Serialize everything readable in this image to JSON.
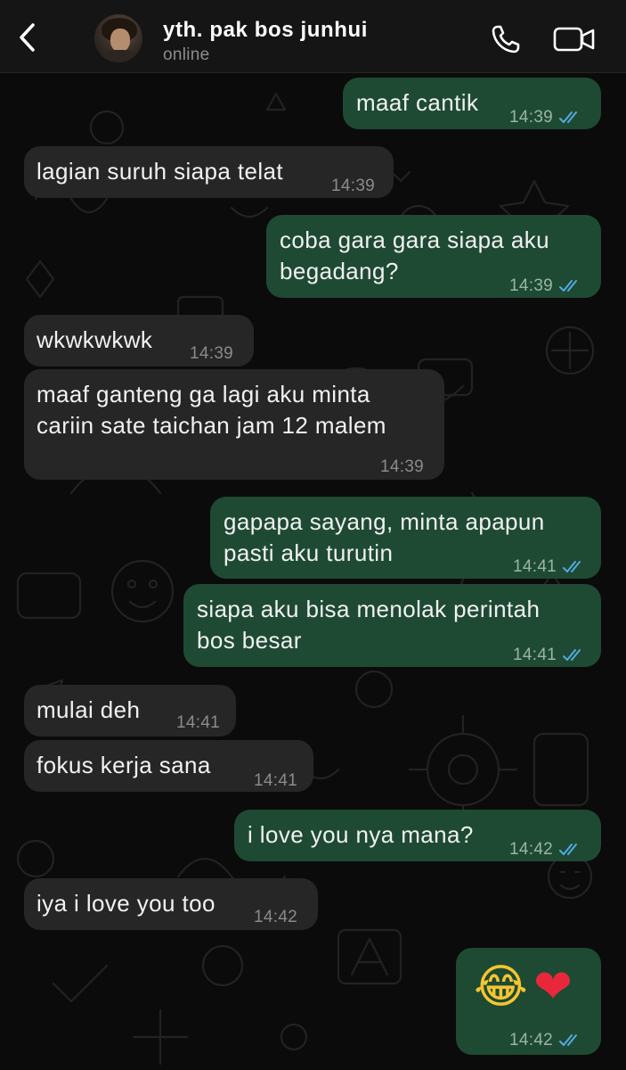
{
  "header": {
    "contact_name": "yth. pak bos junhui",
    "status": "online",
    "icons": {
      "back": "chevron-left-icon",
      "call": "phone-icon",
      "video": "video-camera-icon"
    }
  },
  "colors": {
    "background": "#0b0b0b",
    "header": "#151515",
    "incoming_bubble": "#262626",
    "outgoing_bubble": "#1e4a33",
    "read_ticks": "#53a9e4"
  },
  "messages": [
    {
      "direction": "out",
      "lines": [
        "maaf cantik"
      ],
      "time": "14:39",
      "read": true
    },
    {
      "direction": "in",
      "lines": [
        "lagian suruh siapa telat"
      ],
      "time": "14:39"
    },
    {
      "direction": "out",
      "lines": [
        "coba gara gara siapa aku",
        "begadang?"
      ],
      "time": "14:39",
      "read": true
    },
    {
      "direction": "in",
      "lines": [
        "wkwkwkwk"
      ],
      "time": "14:39"
    },
    {
      "direction": "in",
      "lines": [
        "maaf ganteng ga lagi aku minta",
        "cariin sate taichan jam 12 malem"
      ],
      "time": "14:39"
    },
    {
      "direction": "out",
      "lines": [
        "gapapa sayang, minta apapun",
        "pasti aku turutin"
      ],
      "time": "14:41",
      "read": true
    },
    {
      "direction": "out",
      "lines": [
        "siapa aku bisa menolak perintah",
        "bos besar"
      ],
      "time": "14:41",
      "read": true
    },
    {
      "direction": "in",
      "lines": [
        "mulai deh"
      ],
      "time": "14:41"
    },
    {
      "direction": "in",
      "lines": [
        "fokus kerja sana"
      ],
      "time": "14:41"
    },
    {
      "direction": "out",
      "lines": [
        "i love you nya mana?"
      ],
      "time": "14:42",
      "read": true
    },
    {
      "direction": "in",
      "lines": [
        "iya i love you too"
      ],
      "time": "14:42"
    },
    {
      "direction": "out",
      "emoji": [
        "face-with-tears-of-joy",
        "red-heart"
      ],
      "time": "14:42",
      "read": true
    }
  ]
}
